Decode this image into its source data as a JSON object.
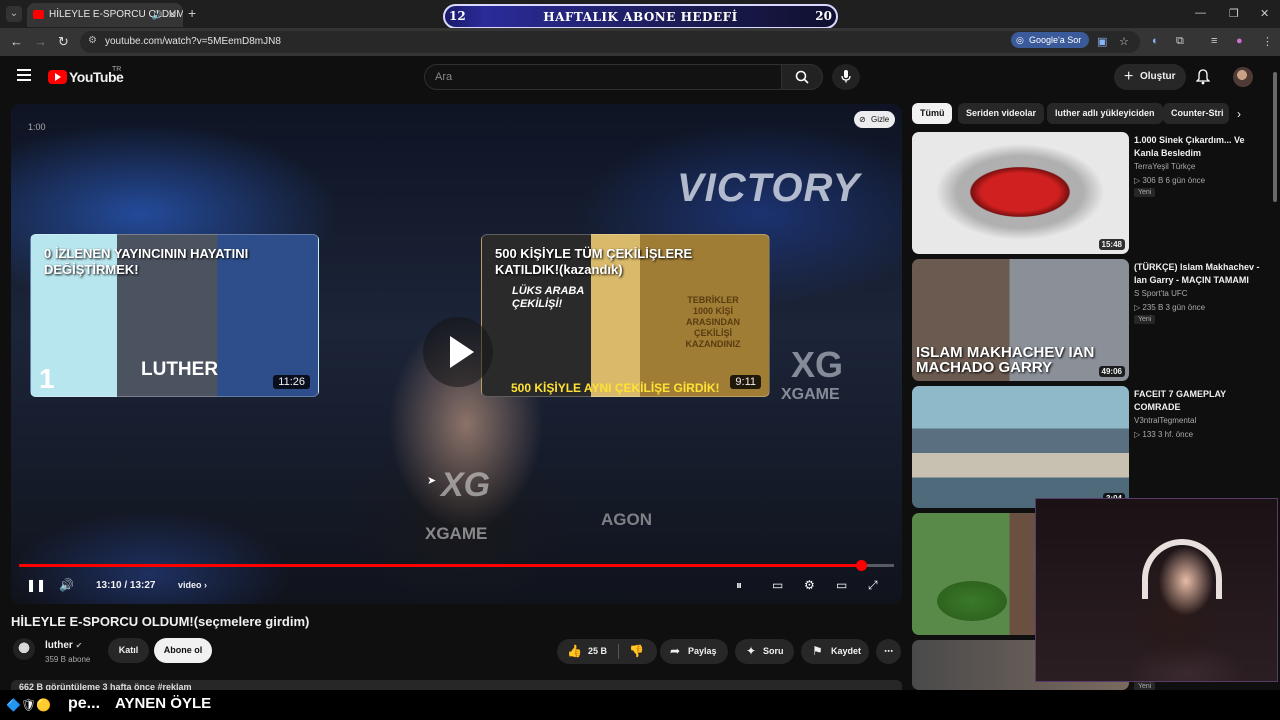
{
  "browser": {
    "tab_title": "HİLEYLE E-SPORCU OLDUM",
    "url": "youtube.com/watch?v=5MEemD8mJN8",
    "google_ask_label": "Google'a Sor"
  },
  "goal_banner": {
    "left": "12",
    "title": "HAFTALIK ABONE HEDEFİ",
    "right": "20"
  },
  "youtube": {
    "logo": "YouTube",
    "country": "TR",
    "search_placeholder": "Ara",
    "create_label": "Oluştur"
  },
  "player": {
    "timecode_overlay": "1:00",
    "hide_label": "Gizle",
    "current_time": "13:10",
    "duration": "13:27",
    "time_display": "13:10 / 13:27",
    "chapter_label": "video",
    "progress_fraction": 0.962,
    "endcards": [
      {
        "title_line1": "0 İZLENEN YAYINCININ HAYATINI",
        "title_line2": "DEĞİŞTİRMEK!",
        "duration": "11:26",
        "name_overlay": "LUTHER"
      },
      {
        "title_line1": "500 KİŞİYLE TÜM ÇEKİLİŞLERE",
        "title_line2": "KATILDIK!(kazandık)",
        "duration": "9:11",
        "luks": "LÜKS ARABA ÇEKİLİŞİ!",
        "tebrik": "TEBRİKLER 1000 KİŞİ ARASINDAN ÇEKİLİŞİ KAZANDINIZ",
        "subtitle": "500 KİŞİYLE AYNI ÇEKİLİŞE GİRDİK!"
      }
    ],
    "scene_text": {
      "victory": "VICTORY",
      "xg": "XG",
      "xgame": "XGAME",
      "agon": "AGON"
    }
  },
  "video": {
    "title": "HİLEYLE E-SPORCU OLDUM!(seçmelere girdim)",
    "channel": "luther",
    "subscribers": "359 B abone",
    "join_label": "Katıl",
    "subscribe_label": "Abone ol",
    "likes": "25 B",
    "share_label": "Paylaş",
    "ask_label": "Soru",
    "save_label": "Kaydet",
    "views_line": "662 B görüntüleme  3 hafta önce  #reklam"
  },
  "sidebar": {
    "chips": [
      "Tümü",
      "Seriden videolar",
      "luther adlı yükleyiciden",
      "Counter-Stri"
    ],
    "recommendations": [
      {
        "title": "1.000 Sinek Çıkardım... Ve Kanla Besledim",
        "channel": "TerraYeşil Türkçe",
        "meta": "▷ 306 B   6 gün önce",
        "badge": "Yeni",
        "duration": "15:48"
      },
      {
        "title": "(TÜRKÇE) Islam Makhachev - Ian Garry - MAÇIN TAMAMI",
        "channel": "S Sport'ta UFC",
        "meta": "▷ 235 B   3 gün önce",
        "badge": "Yeni",
        "duration": "49:06",
        "thumb_text": "ISLAM MAKHACHEV IAN MACHADO GARRY"
      },
      {
        "title": "FACEIT 7 GAMEPLAY COMRADE",
        "channel": "V3ntralTegmental",
        "meta": "▷ 133   3 hf. önce",
        "badge": "",
        "duration": "3:04"
      },
      {
        "title": "",
        "channel": "",
        "meta": "",
        "badge": "",
        "duration": ""
      },
      {
        "title": "",
        "channel": "",
        "meta": "",
        "badge": "Yeni",
        "duration": ""
      }
    ]
  },
  "stream_overlay": {
    "ticker_user": "pe...",
    "ticker_text": "AYNEN ÖYLE"
  }
}
